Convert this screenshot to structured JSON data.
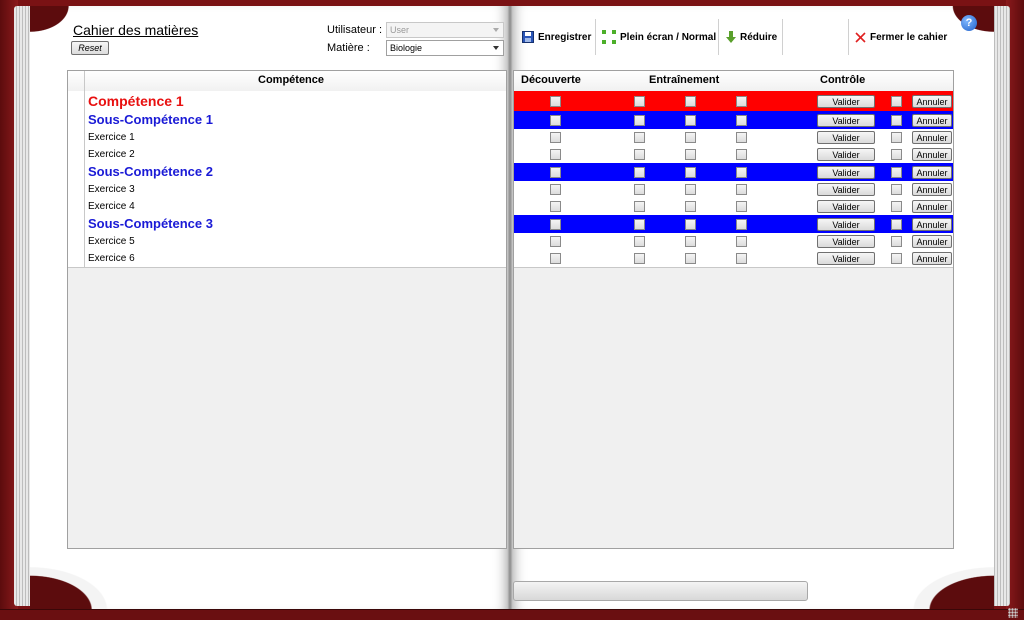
{
  "header": {
    "title": "Cahier des matières",
    "reset_label": "Reset",
    "user_label": "Utilisateur :",
    "user_value": "User",
    "subject_label": "Matière :",
    "subject_value": "Biologie"
  },
  "toolbar": {
    "save_label": "Enregistrer",
    "fullscreen_label": "Plein écran / Normal",
    "minimize_label": "Réduire",
    "close_label": "Fermer le cahier",
    "help_glyph": "?"
  },
  "grid_left": {
    "column_header": "Compétence",
    "rows": [
      {
        "name": "Compétence 1",
        "level": "comp"
      },
      {
        "name": "Sous-Compétence 1",
        "level": "sub"
      },
      {
        "name": "Exercice 1",
        "level": "ex"
      },
      {
        "name": "Exercice 2",
        "level": "ex"
      },
      {
        "name": "Sous-Compétence 2",
        "level": "sub"
      },
      {
        "name": "Exercice 3",
        "level": "ex"
      },
      {
        "name": "Exercice 4",
        "level": "ex"
      },
      {
        "name": "Sous-Compétence 3",
        "level": "sub"
      },
      {
        "name": "Exercice 5",
        "level": "ex"
      },
      {
        "name": "Exercice 6",
        "level": "ex"
      }
    ]
  },
  "grid_right": {
    "headers": {
      "decouverte": "Découverte",
      "entrainement": "Entraînement",
      "controle": "Contrôle"
    },
    "valider_label": "Valider",
    "annuler_label": "Annuler",
    "row_colors": [
      "red",
      "blue",
      "white",
      "white",
      "blue",
      "white",
      "white",
      "blue",
      "white",
      "white"
    ]
  },
  "colors": {
    "competence": "#e81010",
    "sous_competence": "#1a1ad6",
    "row_red": "#ff0000",
    "row_blue": "#0000ff",
    "book_cover": "#7a1214"
  }
}
